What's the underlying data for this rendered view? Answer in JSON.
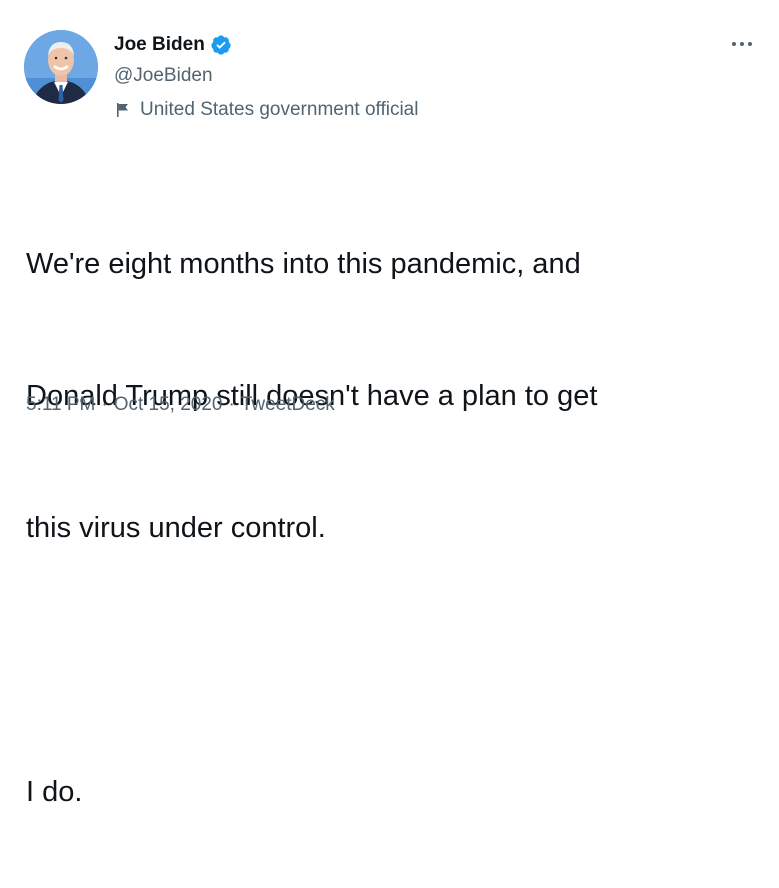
{
  "author": {
    "display_name": "Joe Biden",
    "handle": "@JoeBiden",
    "verified": true,
    "label": "United States government official",
    "label_icon": "flag-icon",
    "verified_color": "#1d9bf0"
  },
  "tweet": {
    "lines": [
      "We're eight months into this pandemic, and",
      "Donald Trump still doesn't have a plan to get",
      "this virus under control."
    ],
    "line2": "I do."
  },
  "meta": {
    "time": "5:11 PM",
    "separator": "·",
    "date": "Oct 15, 2020",
    "source": "TweetDeck"
  },
  "menu": {
    "more_icon": "more-horizontal-icon"
  }
}
